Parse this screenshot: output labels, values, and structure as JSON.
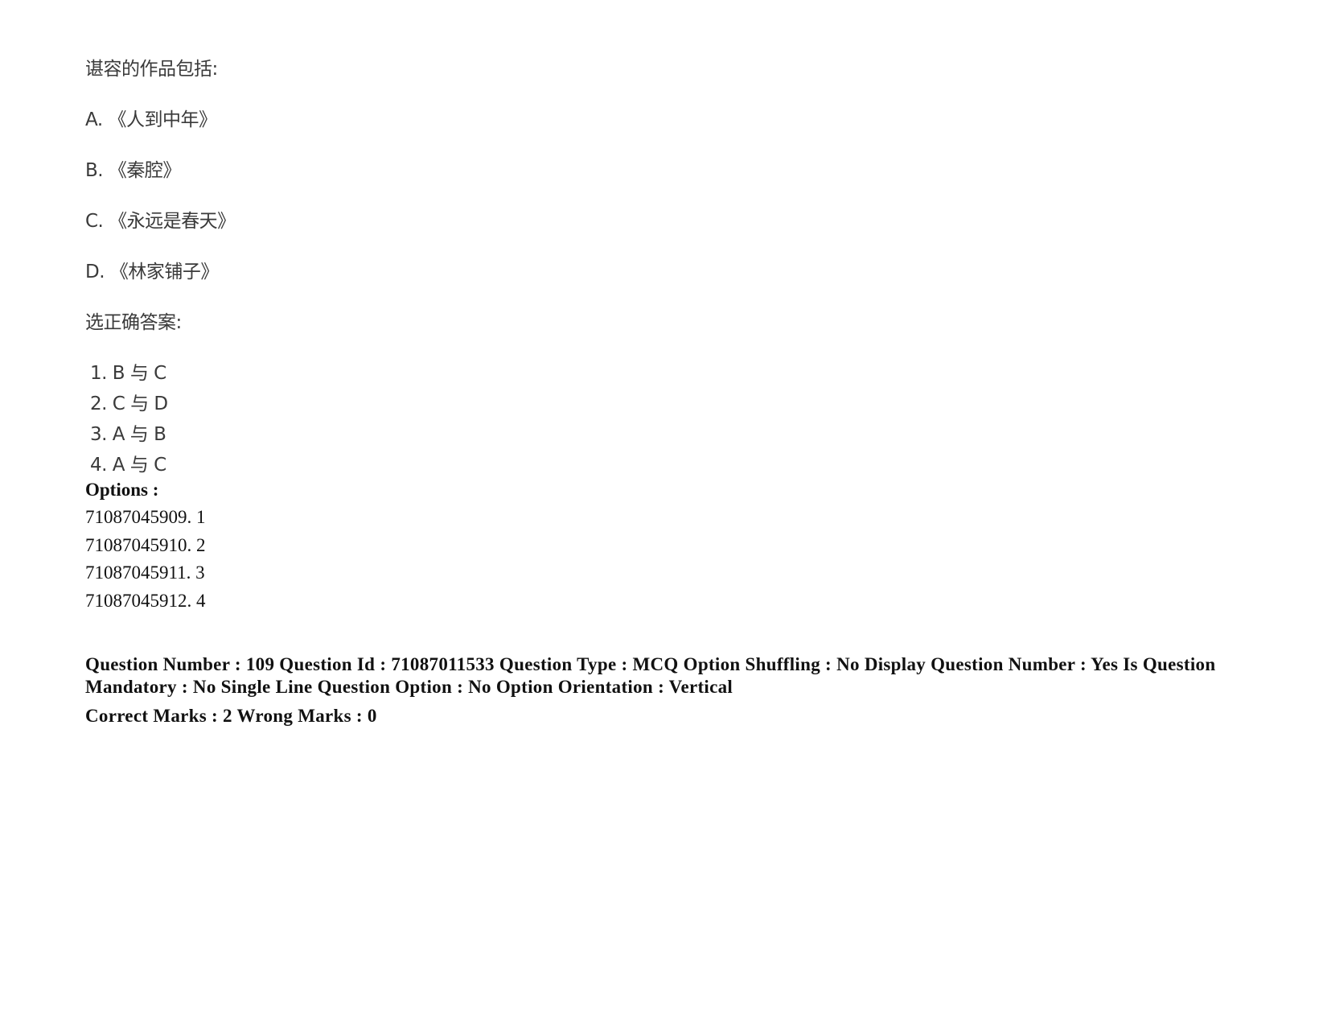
{
  "question": {
    "stem": "谌容的作品包括:",
    "statements": [
      "A. 《人到中年》",
      "B. 《秦腔》",
      "C. 《永远是春天》",
      "D. 《林家铺子》"
    ],
    "prompt": "选正确答案:",
    "answers": [
      "1. B 与 C",
      "2. C 与 D",
      "3. A 与 B",
      "4. A 与 C"
    ]
  },
  "options": {
    "label": "Options :",
    "items": [
      "71087045909. 1",
      "71087045910. 2",
      "71087045911. 3",
      "71087045912. 4"
    ]
  },
  "next_question_meta": {
    "line": "Question Number : 109 Question Id : 71087011533 Question Type : MCQ Option Shuffling : No Display Question Number : Yes Is Question Mandatory : No Single Line Question Option : No Option Orientation : Vertical",
    "marks": "Correct Marks : 2 Wrong Marks : 0"
  }
}
